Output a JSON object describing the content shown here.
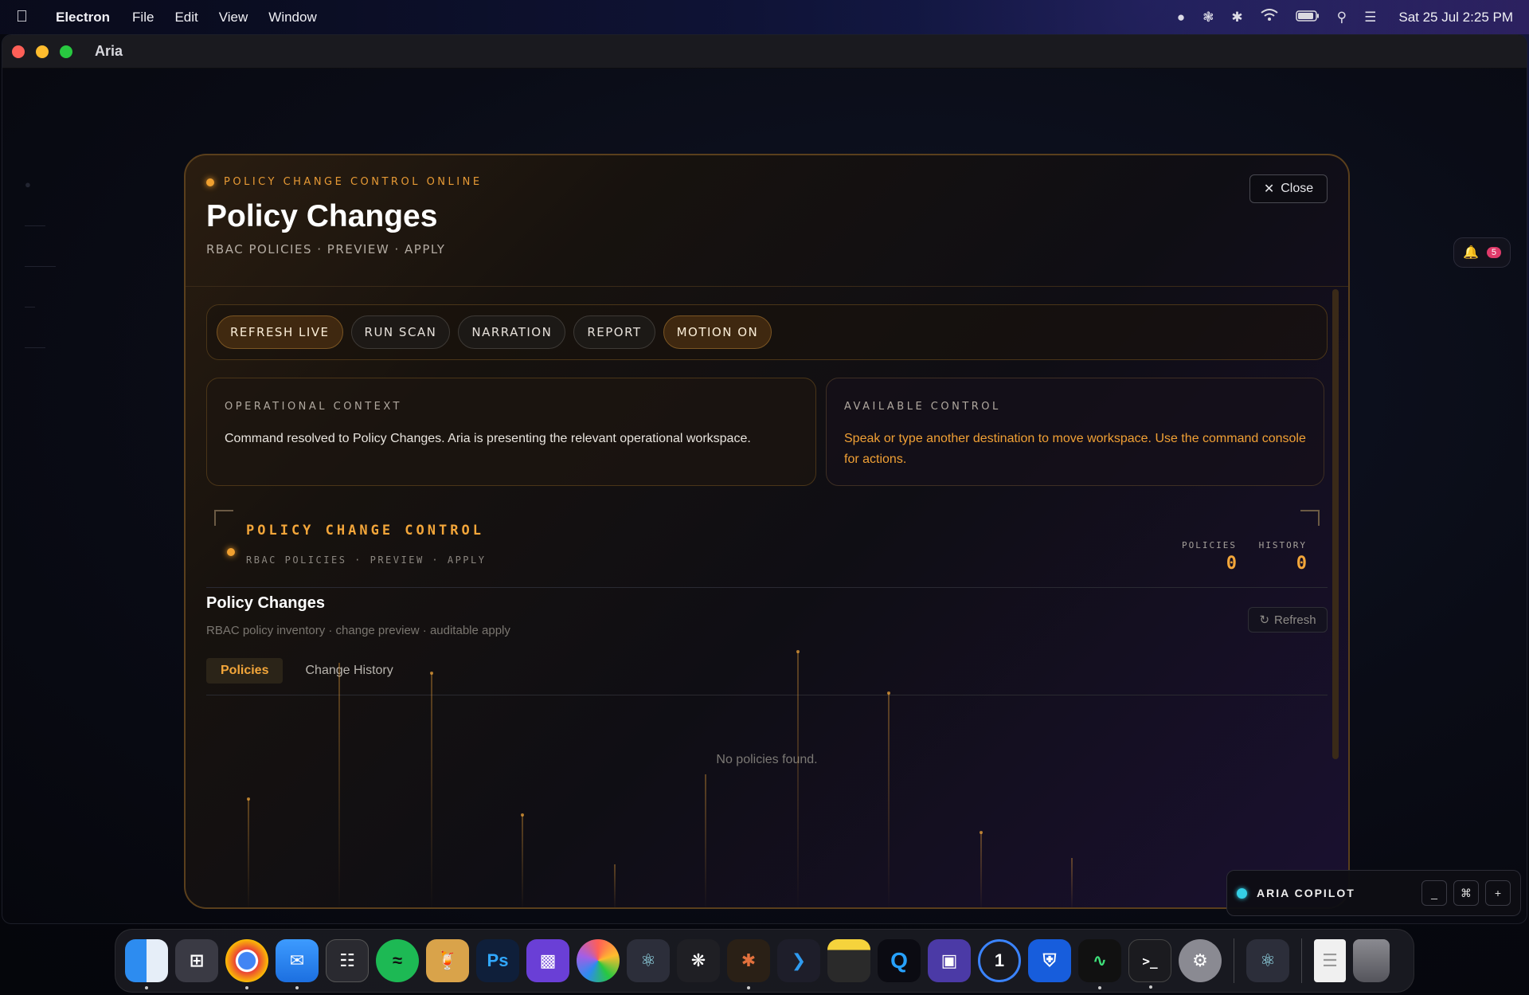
{
  "menubar": {
    "app_name": "Electron",
    "menus": [
      "File",
      "Edit",
      "View",
      "Window"
    ],
    "clock": "Sat 25 Jul  2:25 PM"
  },
  "window": {
    "title": "Aria"
  },
  "notifications": {
    "count": "5"
  },
  "modal": {
    "status": "POLICY CHANGE CONTROL ONLINE",
    "title": "Policy Changes",
    "subtitle": "RBAC POLICIES · PREVIEW · APPLY",
    "close_label": "Close",
    "toolbar": [
      "REFRESH LIVE",
      "RUN SCAN",
      "NARRATION",
      "REPORT",
      "MOTION ON"
    ],
    "context_card": {
      "label": "OPERATIONAL CONTEXT",
      "text": "Command resolved to Policy Changes. Aria is presenting the relevant operational workspace."
    },
    "control_card": {
      "label": "AVAILABLE CONTROL",
      "text": "Speak or type another destination to move workspace. Use the command console for actions."
    },
    "pcc": {
      "title": "POLICY CHANGE CONTROL",
      "subtitle": "RBAC POLICIES · PREVIEW · APPLY",
      "policies_label": "POLICIES",
      "policies_value": "0",
      "history_label": "HISTORY",
      "history_value": "0"
    },
    "section": {
      "title": "Policy Changes",
      "subtitle": "RBAC policy inventory · change preview · auditable apply",
      "refresh_label": "Refresh",
      "tabs": [
        "Policies",
        "Change History"
      ],
      "empty_text": "No policies found."
    }
  },
  "copilot": {
    "label": "ARIA COPILOT",
    "controls": [
      "_",
      "⌘",
      "+"
    ]
  },
  "colors": {
    "accent": "#f3a63a",
    "copilot_dot": "#35d0e6",
    "badge": "#e03a6a"
  },
  "dock": {
    "apps": [
      "finder-icon",
      "launchpad-icon",
      "chrome-icon",
      "mail-icon",
      "calendar-icon",
      "spotify-icon",
      "cocktail-icon",
      "photoshop-icon",
      "claquette-icon",
      "photos-icon",
      "electron-icon",
      "chatgpt-icon",
      "claude-icon",
      "vscode-icon",
      "notes-icon",
      "q-icon",
      "proton-icon",
      "onepassword-icon",
      "bitwarden-icon",
      "activity-monitor-icon",
      "terminal-icon",
      "settings-icon"
    ],
    "ps_label": "Ps"
  }
}
